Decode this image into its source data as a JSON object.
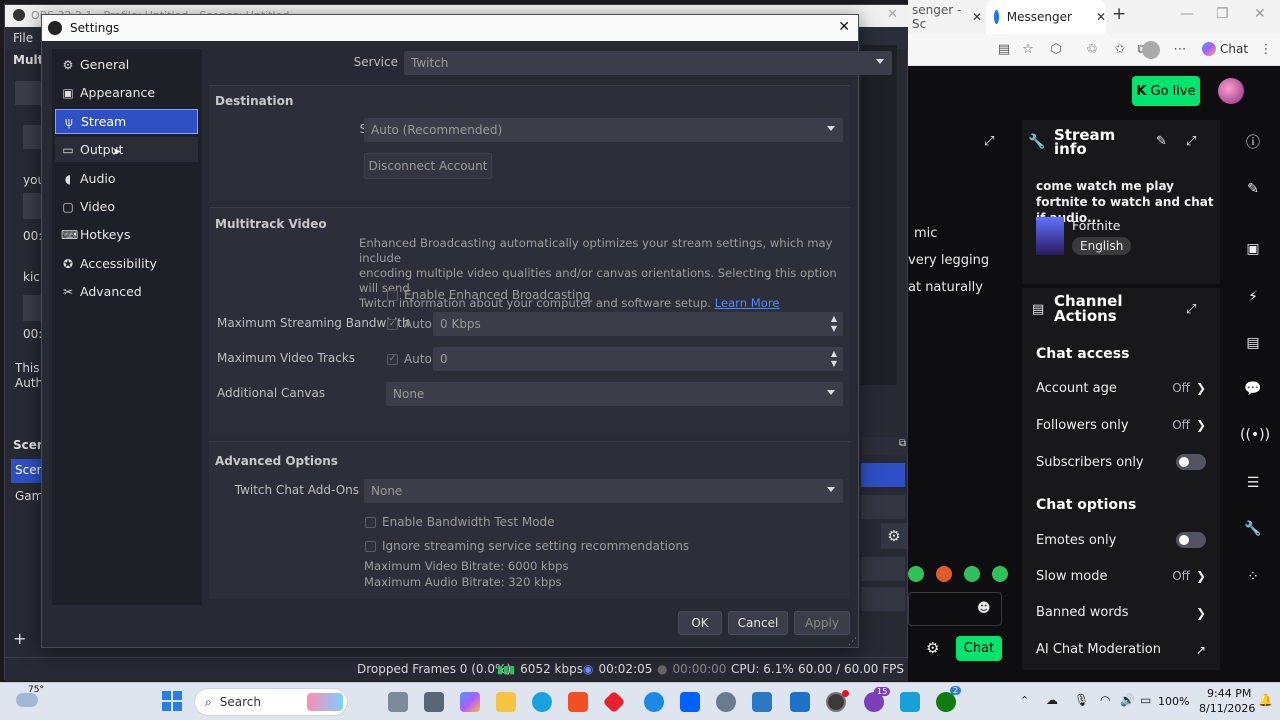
{
  "obs_main": {
    "title": "OBS 32.2.1 - Profile: Untitled - Scenes: Untitled",
    "menu_file": "File",
    "left_snips": [
      "Multi",
      "yout",
      "00:0",
      "kick",
      "00:0",
      "This p",
      "Autho"
    ],
    "scenes_label": "Scene",
    "scene_items": [
      "Scene",
      "Gami"
    ],
    "status": {
      "dropped_frames": "Dropped Frames 0 (0.0%)",
      "bitrate": "6052 kbps",
      "stream_time": "00:02:05",
      "rec_time": "00:00:00",
      "cpu": "CPU: 6.1%",
      "fps": "60.00 / 60.00 FPS"
    }
  },
  "settings": {
    "title": "Settings",
    "sidebar": [
      {
        "label": "General",
        "icon": "gear-icon",
        "glyph": "⚙"
      },
      {
        "label": "Appearance",
        "icon": "palette-icon",
        "glyph": "▣"
      },
      {
        "label": "Stream",
        "icon": "antenna-icon",
        "glyph": "📡"
      },
      {
        "label": "Output",
        "icon": "output-icon",
        "glyph": "▭"
      },
      {
        "label": "Audio",
        "icon": "speaker-icon",
        "glyph": "🔊"
      },
      {
        "label": "Video",
        "icon": "monitor-icon",
        "glyph": "▢"
      },
      {
        "label": "Hotkeys",
        "icon": "keyboard-icon",
        "glyph": "⌨"
      },
      {
        "label": "Accessibility",
        "icon": "accessibility-icon",
        "glyph": "♿"
      },
      {
        "label": "Advanced",
        "icon": "wrench-icon",
        "glyph": "✂"
      }
    ],
    "selected": "Stream",
    "service_label": "Service",
    "service_value": "Twitch",
    "destination": {
      "title": "Destination",
      "server_label": "Server",
      "server_value": "Auto (Recommended)",
      "disconnect": "Disconnect Account"
    },
    "multitrack": {
      "title": "Multitrack Video",
      "desc_lines": [
        "Enhanced Broadcasting automatically optimizes your stream settings, which may include",
        "encoding multiple video qualities and/or canvas orientations. Selecting this option will send",
        "Twitch information about your computer and software setup."
      ],
      "learn_more": "Learn More",
      "enable_label": "Enable Enhanced Broadcasting",
      "max_bw_label": "Maximum Streaming Bandwidth",
      "max_bw_auto": "Auto",
      "max_bw_value": "0 Kbps",
      "max_tracks_label": "Maximum Video Tracks",
      "max_tracks_auto": "Auto",
      "max_tracks_value": "0",
      "add_canvas_label": "Additional Canvas",
      "add_canvas_value": "None"
    },
    "advanced": {
      "title": "Advanced Options",
      "chat_addons_label": "Twitch Chat Add-Ons",
      "chat_addons_value": "None",
      "bw_test": "Enable Bandwidth Test Mode",
      "ignore_reco": "Ignore streaming service setting recommendations",
      "max_video": "Maximum Video Bitrate: 6000 kbps",
      "max_audio": "Maximum Audio Bitrate: 320 kbps"
    },
    "buttons": {
      "ok": "OK",
      "cancel": "Cancel",
      "apply": "Apply"
    }
  },
  "browser": {
    "tab_inactive": "senger - Sc",
    "tab_active": "Messenger",
    "copilot": "Chat",
    "golive": "Go live",
    "chat_snips": [
      "mic",
      "very legging",
      "at naturally"
    ],
    "chat_button": "Chat",
    "stream_info": {
      "title_line1": "Stream",
      "title_line2": "info",
      "stream_title": "come watch me play fortnite to watch and chat if audio...",
      "game": "Fortnite",
      "language": "English"
    },
    "channel_actions": {
      "title_line1": "Channel",
      "title_line2": "Actions",
      "chat_access": "Chat access",
      "account_age": "Account age",
      "account_age_val": "Off",
      "followers_only": "Followers only",
      "followers_only_val": "Off",
      "subscribers_only": "Subscribers only",
      "chat_options": "Chat options",
      "emotes_only": "Emotes only",
      "slow_mode": "Slow mode",
      "slow_mode_val": "Off",
      "banned_words": "Banned words",
      "ai_moderation": "AI Chat Moderation"
    }
  },
  "taskbar": {
    "weather": "75°",
    "search": "Search",
    "battery": "100%",
    "time": "9:44 PM",
    "date": "8/11/2026",
    "badge_15": "15",
    "badge_2": "2"
  },
  "colors": {
    "obs_bg": "#272a33",
    "selected": "#2f50c4",
    "twitch_green": "#00e56e",
    "link": "#4b8bff"
  }
}
